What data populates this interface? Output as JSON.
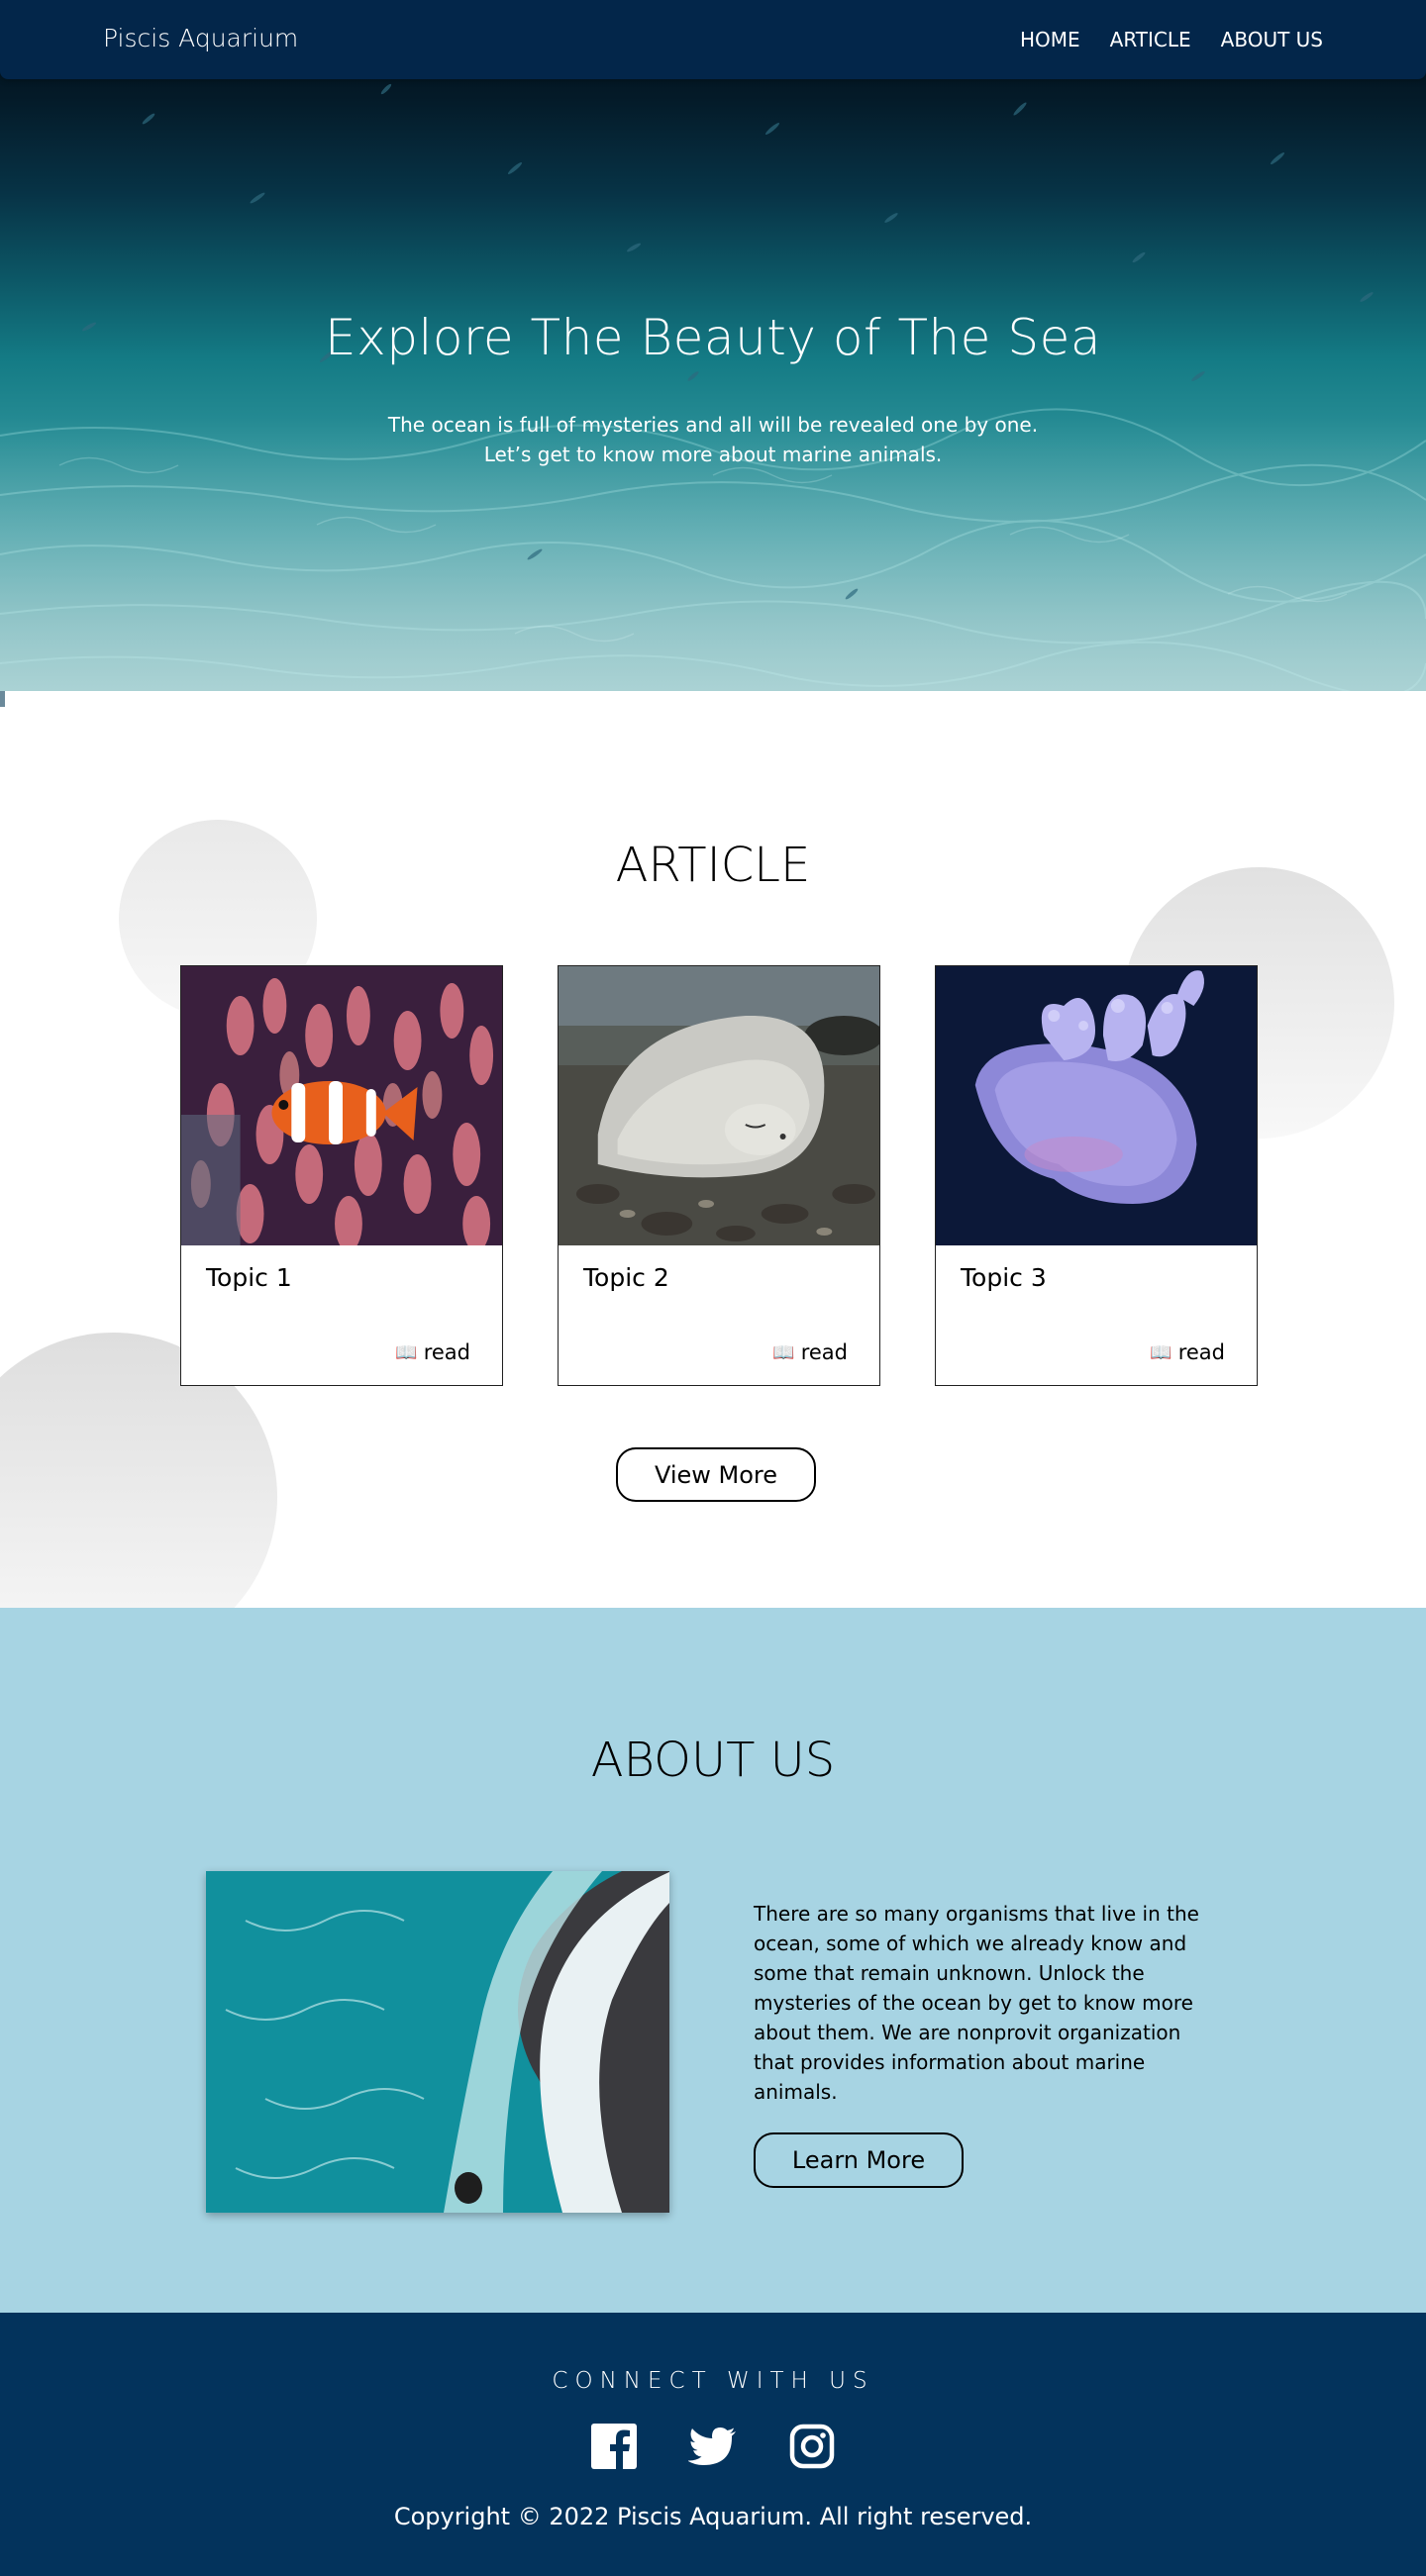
{
  "nav": {
    "brand": "Piscis Aquarium",
    "links": [
      "HOME",
      "ARTICLE",
      "ABOUT US"
    ]
  },
  "hero": {
    "title": "Explore The Beauty of The Sea",
    "subtitle_line1": "The ocean is full of mysteries and all will be revealed one by one.",
    "subtitle_line2": "Let’s get to know more about marine animals."
  },
  "article": {
    "title": "ARTICLE",
    "cards": [
      {
        "title": "Topic 1",
        "read_label": "read",
        "image": "clownfish-anemone"
      },
      {
        "title": "Topic 2",
        "read_label": "read",
        "image": "seal-on-rocks"
      },
      {
        "title": "Topic 3",
        "read_label": "read",
        "image": "jellyfish"
      }
    ],
    "view_more_label": "View More"
  },
  "about": {
    "title": "ABOUT US",
    "text": "There are so many organisms that live in the ocean, some of which we already know and some that remain unknown. Unlock the mysteries of the ocean by get to know more about them. We are nonprovit organization that provides information about marine animals.",
    "learn_more_label": "Learn More",
    "image": "ocean-waves-aerial"
  },
  "footer": {
    "title": "CONNECT WITH US",
    "social": [
      "facebook-icon",
      "twitter-icon",
      "instagram-icon"
    ],
    "copyright": "Copyright © 2022 Piscis Aquarium. All right reserved."
  },
  "colors": {
    "navbar": "#03264a",
    "about_bg": "#a7d4e3",
    "footer_bg": "#03335c"
  }
}
